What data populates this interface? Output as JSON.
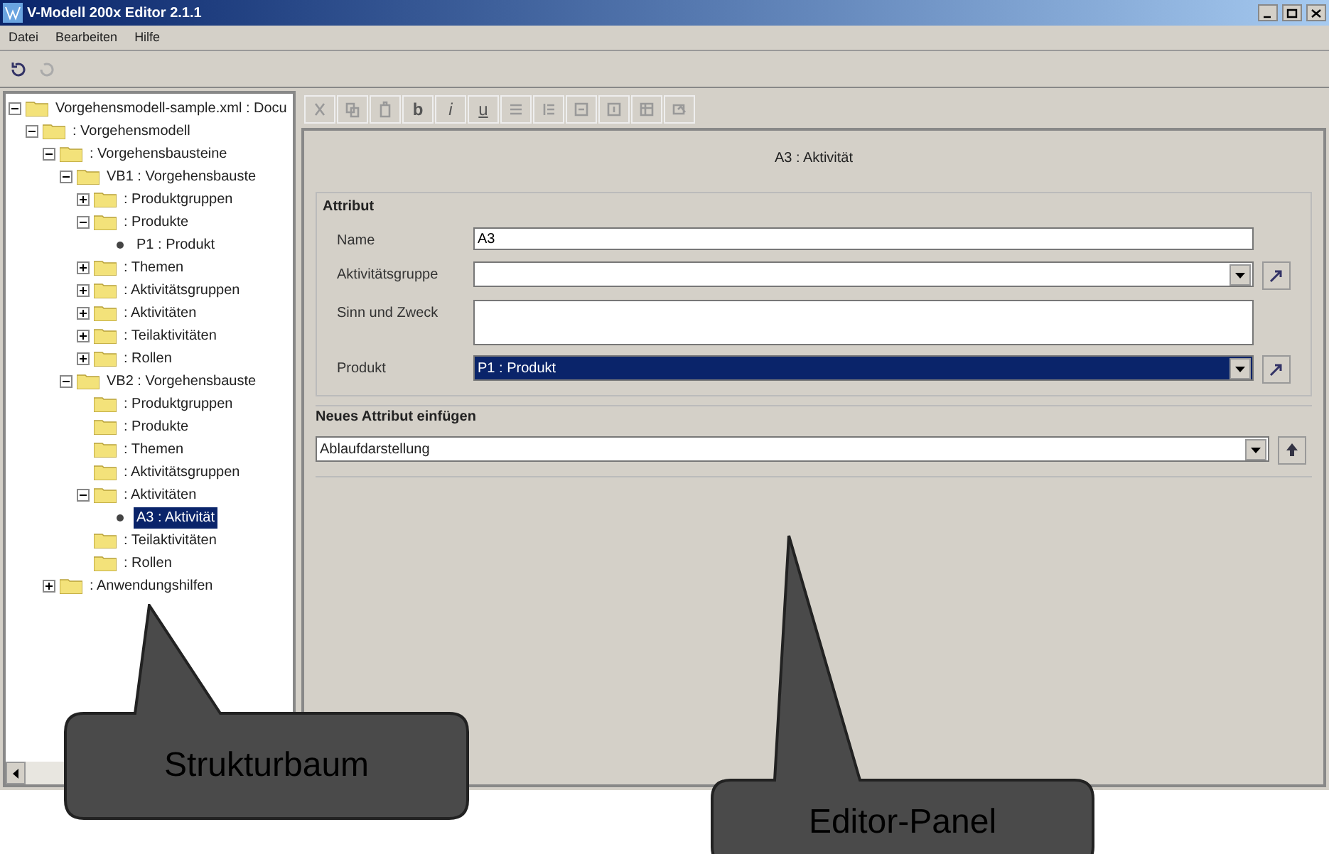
{
  "window": {
    "title": "V-Modell 200x Editor 2.1.1"
  },
  "menu": [
    "Datei",
    "Bearbeiten",
    "Hilfe"
  ],
  "tree": [
    {
      "label": "Vorgehensmodell-sample.xml : Docu",
      "kind": "folder",
      "has_children": true,
      "expanded": true,
      "selected": false,
      "children": [
        {
          "label": ": Vorgehensmodell",
          "kind": "folder",
          "has_children": true,
          "expanded": true,
          "selected": false,
          "children": [
            {
              "label": ": Vorgehensbausteine",
              "kind": "folder",
              "has_children": true,
              "expanded": true,
              "selected": false,
              "children": [
                {
                  "label": "VB1 : Vorgehensbauste",
                  "kind": "folder",
                  "has_children": true,
                  "expanded": true,
                  "selected": false,
                  "children": [
                    {
                      "label": ": Produktgruppen",
                      "kind": "folder",
                      "has_children": true,
                      "expanded": false,
                      "selected": false
                    },
                    {
                      "label": ": Produkte",
                      "kind": "folder",
                      "has_children": true,
                      "expanded": true,
                      "selected": false,
                      "children": [
                        {
                          "label": "P1 : Produkt",
                          "kind": "item",
                          "has_children": false,
                          "expanded": false,
                          "selected": false
                        }
                      ]
                    },
                    {
                      "label": ": Themen",
                      "kind": "folder",
                      "has_children": true,
                      "expanded": false,
                      "selected": false
                    },
                    {
                      "label": ": Aktivitätsgruppen",
                      "kind": "folder",
                      "has_children": true,
                      "expanded": false,
                      "selected": false
                    },
                    {
                      "label": ": Aktivitäten",
                      "kind": "folder",
                      "has_children": true,
                      "expanded": false,
                      "selected": false
                    },
                    {
                      "label": ": Teilaktivitäten",
                      "kind": "folder",
                      "has_children": true,
                      "expanded": false,
                      "selected": false
                    },
                    {
                      "label": ": Rollen",
                      "kind": "folder",
                      "has_children": true,
                      "expanded": false,
                      "selected": false
                    }
                  ]
                },
                {
                  "label": "VB2 : Vorgehensbauste",
                  "kind": "folder",
                  "has_children": true,
                  "expanded": true,
                  "selected": false,
                  "children": [
                    {
                      "label": ": Produktgruppen",
                      "kind": "folder",
                      "has_children": false,
                      "expanded": false,
                      "selected": false
                    },
                    {
                      "label": ": Produkte",
                      "kind": "folder",
                      "has_children": false,
                      "expanded": false,
                      "selected": false
                    },
                    {
                      "label": ": Themen",
                      "kind": "folder",
                      "has_children": false,
                      "expanded": false,
                      "selected": false
                    },
                    {
                      "label": ": Aktivitätsgruppen",
                      "kind": "folder",
                      "has_children": false,
                      "expanded": false,
                      "selected": false
                    },
                    {
                      "label": ": Aktivitäten",
                      "kind": "folder",
                      "has_children": true,
                      "expanded": true,
                      "selected": false,
                      "children": [
                        {
                          "label": "A3 : Aktivität",
                          "kind": "item",
                          "has_children": false,
                          "expanded": false,
                          "selected": true
                        }
                      ]
                    },
                    {
                      "label": ": Teilaktivitäten",
                      "kind": "folder",
                      "has_children": false,
                      "expanded": false,
                      "selected": false
                    },
                    {
                      "label": ": Rollen",
                      "kind": "folder",
                      "has_children": false,
                      "expanded": false,
                      "selected": false
                    }
                  ]
                }
              ]
            },
            {
              "label": ": Anwendungshilfen",
              "kind": "folder",
              "has_children": true,
              "expanded": false,
              "selected": false
            }
          ]
        }
      ]
    }
  ],
  "format_toolbar": [
    {
      "kind": "cut"
    },
    {
      "kind": "copy"
    },
    {
      "kind": "paste"
    },
    {
      "kind": "bold",
      "label": "b"
    },
    {
      "kind": "italic",
      "label": "i"
    },
    {
      "kind": "underline",
      "label": "u"
    },
    {
      "kind": "bullets"
    },
    {
      "kind": "numbers"
    },
    {
      "kind": "indent"
    },
    {
      "kind": "outdent"
    },
    {
      "kind": "table"
    },
    {
      "kind": "image"
    }
  ],
  "editor": {
    "heading": "A3 : Aktivität",
    "attribute_group": {
      "title": "Attribut",
      "fields": [
        {
          "label": "Name",
          "kind": "text",
          "value": "A3"
        },
        {
          "label": "Aktivitätsgruppe",
          "kind": "select",
          "highlighted": false
        },
        {
          "label": "Sinn und Zweck",
          "kind": "textarea"
        },
        {
          "label": "Produkt",
          "kind": "select",
          "value": "P1 : Produkt",
          "highlighted": true
        }
      ]
    },
    "insert_group": {
      "title": "Neues Attribut einfügen",
      "value": "Ablaufdarstellung"
    }
  },
  "callouts": [
    {
      "label": "Strukturbaum"
    },
    {
      "label": "Editor-Panel"
    }
  ]
}
